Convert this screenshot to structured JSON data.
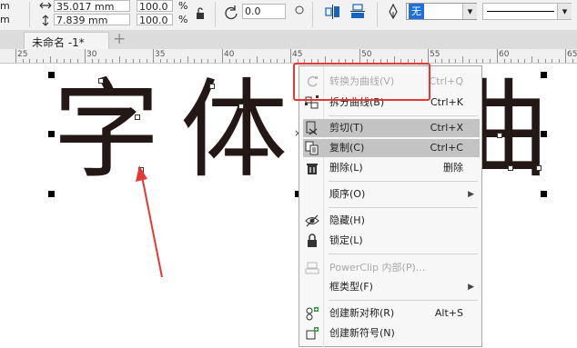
{
  "propbar": {
    "width_value": "35.017 mm",
    "height_value": "7.839 mm",
    "unit_fragment_top": "m",
    "unit_fragment_bottom": "m",
    "scale_x": "100.0",
    "scale_y": "100.0",
    "pct_x": "%",
    "pct_y": "%",
    "rotation_value": "0.0",
    "outline_fill_value": "无",
    "arrow_down": "▾"
  },
  "document": {
    "tab_title": "未命名 -1*",
    "add_tab": "+"
  },
  "ruler": {
    "labels": [
      "25",
      "30",
      "35",
      "40",
      "45",
      "50",
      "55",
      "60",
      "65"
    ]
  },
  "canvas": {
    "glyph_1": "字",
    "glyph_2": "体",
    "glyph_3": "曲"
  },
  "context_menu": {
    "items": [
      {
        "label": "转换为曲线(V)",
        "shortcut": "Ctrl+Q",
        "disabled": true,
        "icon": "convert-to-curves-icon"
      },
      {
        "label": "拆分曲线(B)",
        "shortcut": "Ctrl+K",
        "icon": "break-curve-icon"
      },
      {
        "label": "剪切(T)",
        "shortcut": "Ctrl+X",
        "selected": true,
        "icon": "cut-icon"
      },
      {
        "label": "复制(C)",
        "shortcut": "Ctrl+C",
        "selected": true,
        "icon": "copy-icon"
      },
      {
        "label": "删除(L)",
        "shortcut": "删除",
        "icon": "trash-icon"
      },
      {
        "label": "顺序(O)",
        "submenu": true
      },
      {
        "label": "隐藏(H)",
        "icon": "eye-hidden-icon"
      },
      {
        "label": "锁定(L)",
        "icon": "lock-icon"
      },
      {
        "label": "PowerClip 内部(P)...",
        "disabled": true,
        "icon": "powerclip-icon"
      },
      {
        "label": "框类型(F)",
        "submenu": true
      },
      {
        "label": "创建新对称(R)",
        "shortcut": "Alt+S",
        "icon": "symmetry-icon"
      },
      {
        "label": "创建新符号(N)",
        "icon": "symbol-icon"
      }
    ],
    "submenu_arrow": "▶"
  },
  "colors": {
    "highlight_box": "#e53935",
    "annotation_arrow": "#e53935",
    "glyph_color": "#231815",
    "selected_row": "#c3c3c3"
  }
}
